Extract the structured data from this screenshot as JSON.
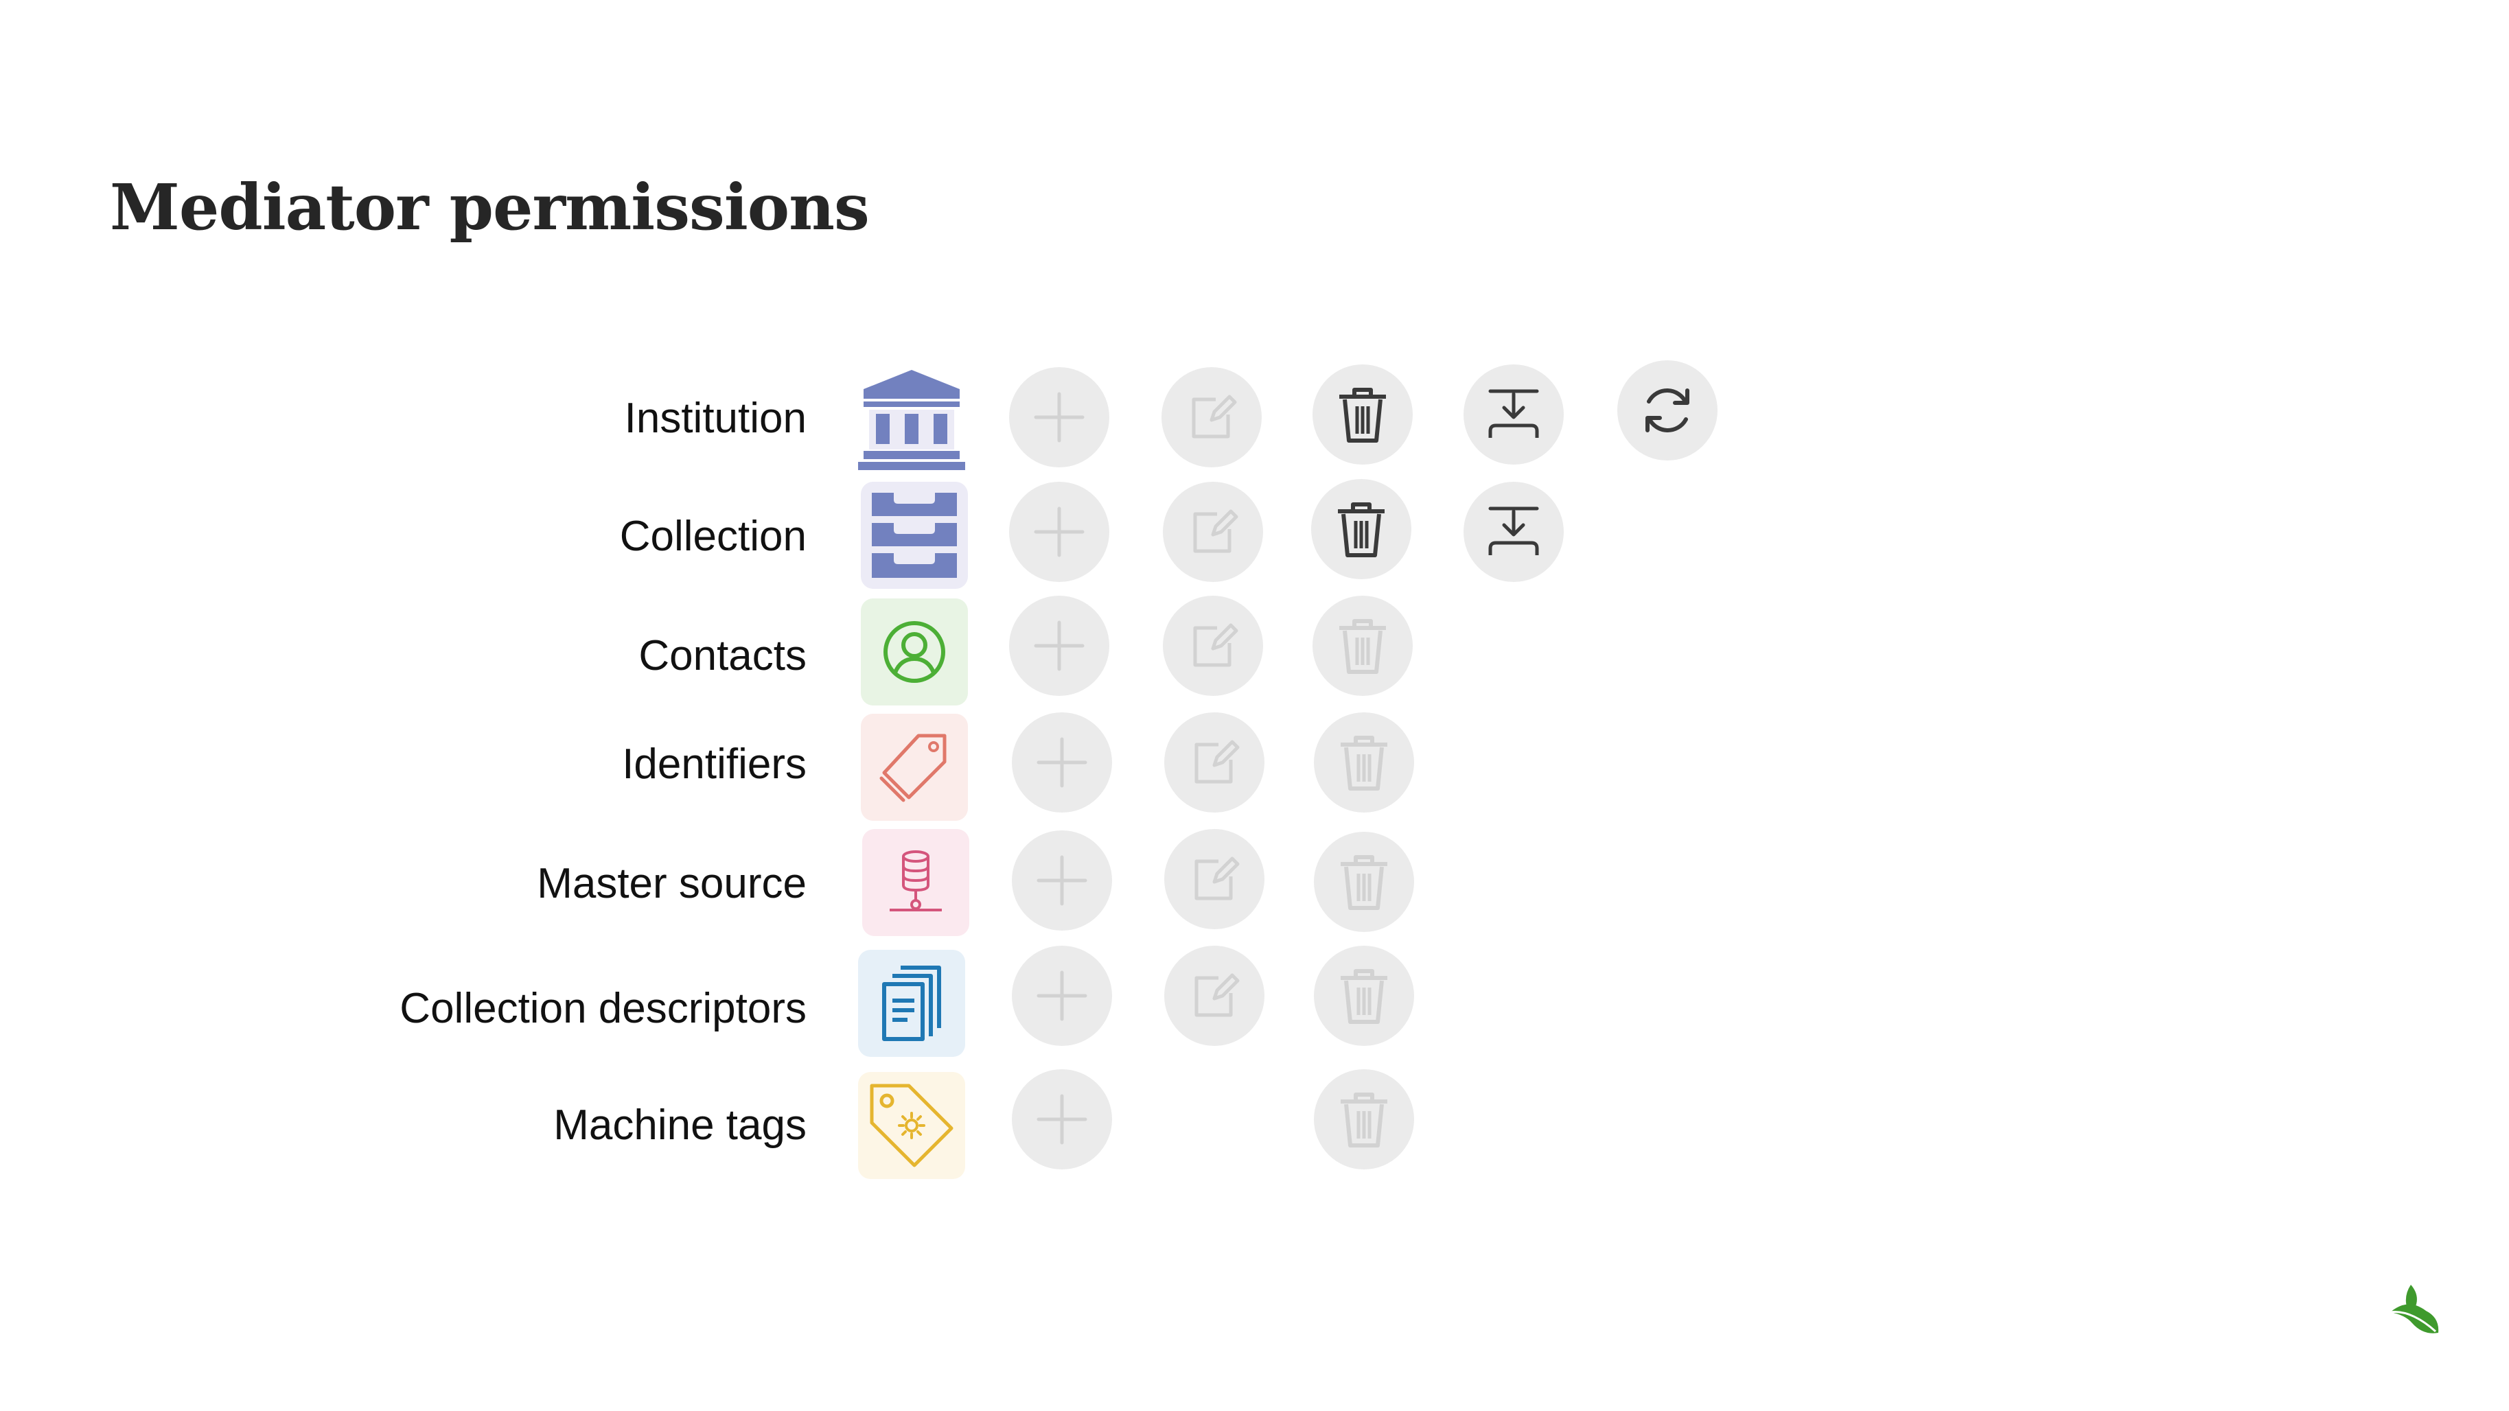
{
  "title": "Mediator permissions",
  "colors": {
    "institution": "#7281bf",
    "contacts": "#4caf36",
    "identifiers": "#e0786a",
    "master_source": "#d4557c",
    "collection_descriptors": "#1f78b4",
    "machine_tags": "#e5b52f",
    "enabled_icon": "#3a3a3a",
    "disabled_icon": "#d2d2d2",
    "button_bg": "#ebebeb",
    "logo": "#3f9a2d"
  },
  "rows": [
    {
      "label": "Institution",
      "icon": "institution-icon",
      "actions": [
        "create-disabled",
        "edit-disabled",
        "delete-enabled",
        "merge-enabled",
        "sync-enabled"
      ]
    },
    {
      "label": "Collection",
      "icon": "collection-drawer-icon",
      "actions": [
        "create-disabled",
        "edit-disabled",
        "delete-enabled",
        "merge-enabled"
      ]
    },
    {
      "label": "Contacts",
      "icon": "person-icon",
      "actions": [
        "create-disabled",
        "edit-disabled",
        "delete-disabled"
      ]
    },
    {
      "label": "Identifiers",
      "icon": "tag-icon",
      "actions": [
        "create-disabled",
        "edit-disabled",
        "delete-disabled"
      ]
    },
    {
      "label": "Master source",
      "icon": "database-icon",
      "actions": [
        "create-disabled",
        "edit-disabled",
        "delete-disabled"
      ]
    },
    {
      "label": "Collection descriptors",
      "icon": "documents-icon",
      "actions": [
        "create-disabled",
        "edit-disabled",
        "delete-disabled"
      ]
    },
    {
      "label": "Machine tags",
      "icon": "machine-tag-icon",
      "actions": [
        "create-disabled",
        "delete-disabled"
      ]
    }
  ],
  "logo_icon": "leaf-logo-icon"
}
